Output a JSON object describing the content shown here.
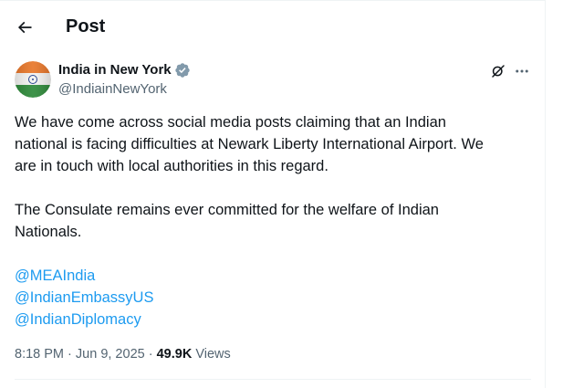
{
  "header": {
    "title": "Post",
    "back_icon": "arrow-left-icon"
  },
  "author": {
    "name": "India in New York",
    "handle": "@IndiainNewYork",
    "verified": true,
    "badge_color": "#829aab",
    "avatar": "indian-flag-avatar"
  },
  "actions": {
    "grok_icon": "grok-icon",
    "more_icon": "more-horizontal-icon"
  },
  "post": {
    "paragraph1": "We have come across social media posts claiming that an Indian\nnational is facing difficulties at Newark Liberty International Airport. We\nare in touch with local authorities in this regard.",
    "paragraph2": "The Consulate remains ever committed for the welfare of Indian\nNationals.",
    "mentions": [
      "@MEAIndia",
      "@IndianEmbassyUS",
      "@IndianDiplomacy"
    ]
  },
  "meta": {
    "time": "8:18 PM",
    "separator": "·",
    "date": "Jun 9, 2025",
    "views_count": "49.9K",
    "views_label": "Views"
  },
  "colors": {
    "link": "#1d9bf0",
    "muted": "#536471",
    "text": "#0f1419"
  }
}
